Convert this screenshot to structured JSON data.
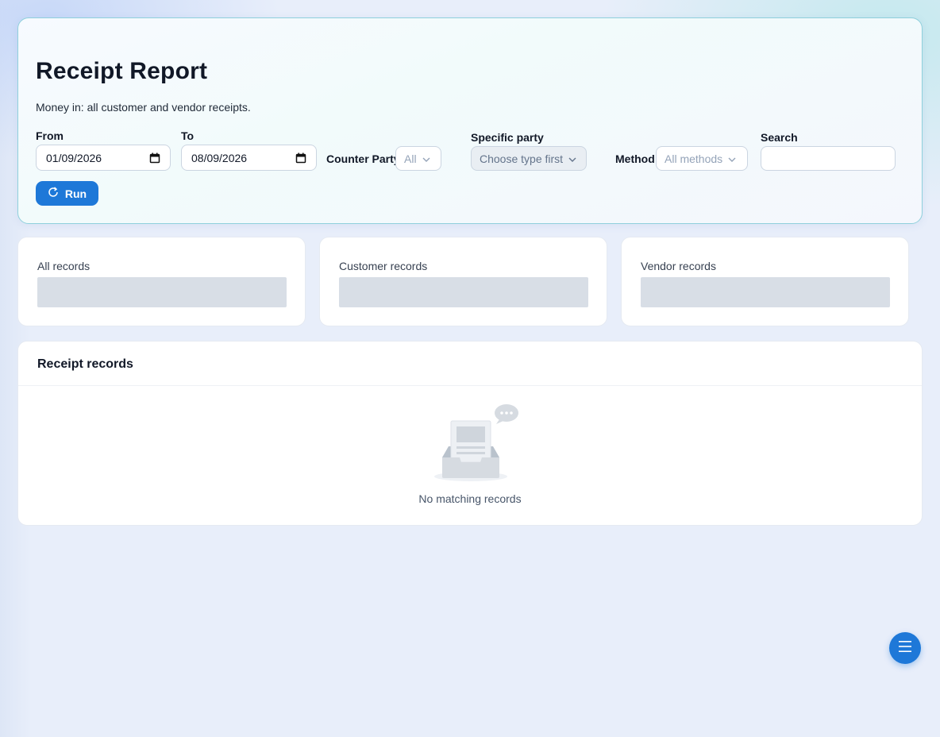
{
  "header": {
    "title": "Receipt Report",
    "subtitle": "Money in: all customer and vendor receipts."
  },
  "filters": {
    "from_label": "From",
    "from_value": "01/09/2026",
    "to_label": "To",
    "to_value": "08/09/2026",
    "counter_party_label": "Counter Party",
    "counter_party_value": "All",
    "specific_party_label": "Specific party",
    "specific_party_placeholder": "Choose type first",
    "method_label": "Method",
    "method_value": "All methods",
    "search_label": "Search",
    "search_value": ""
  },
  "run_button": {
    "label": "Run"
  },
  "stats": [
    {
      "label": "All records"
    },
    {
      "label": "Customer records"
    },
    {
      "label": "Vendor records"
    }
  ],
  "records": {
    "title": "Receipt records",
    "empty_message": "No matching records"
  },
  "icons": {
    "calendar": "calendar-icon",
    "chevron": "chevron-down-icon",
    "refresh": "refresh-icon",
    "menu": "menu-icon",
    "empty_inbox": "empty-inbox-icon"
  },
  "colors": {
    "accent": "#1e78d8",
    "card_border": "#8fd0dc",
    "skeleton": "#d8dee6"
  }
}
